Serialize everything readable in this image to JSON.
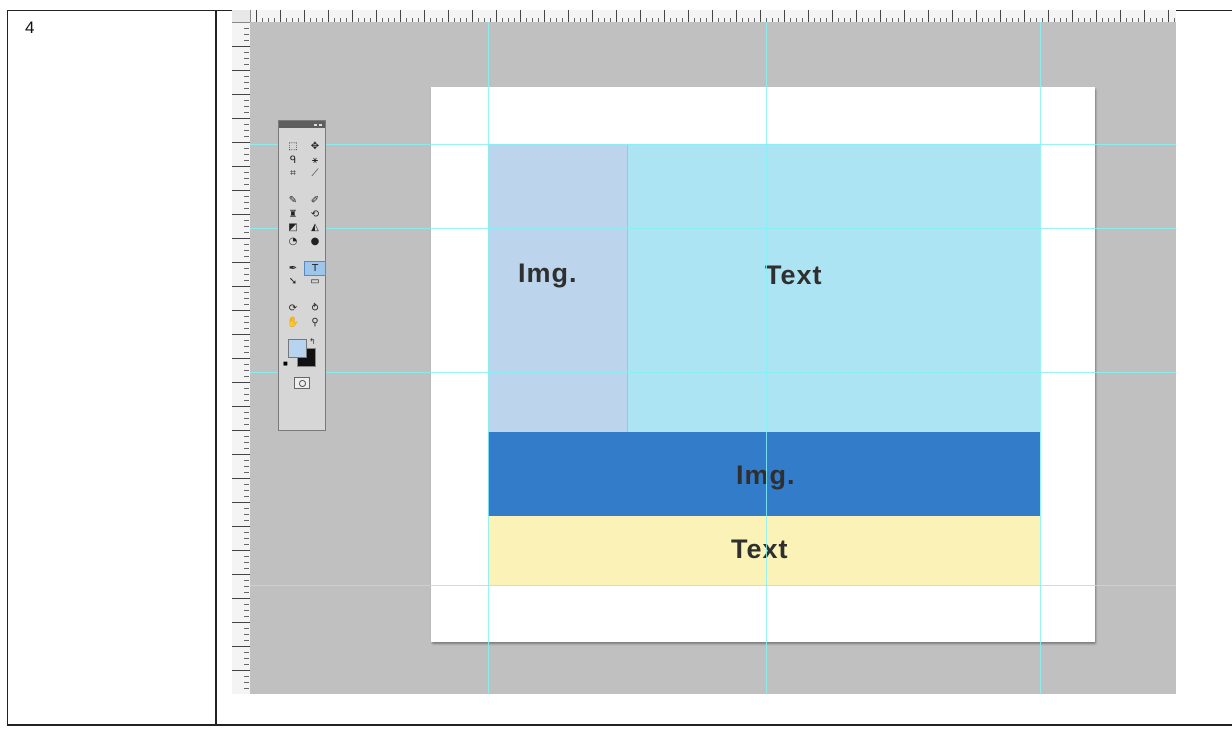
{
  "step": {
    "number": "4"
  },
  "canvas": {
    "blocks": {
      "top_image_label": "Img.",
      "top_text_label": "Text",
      "middle_image_label": "Img.",
      "bottom_text_label": "Text"
    },
    "colors": {
      "workspace": "#c0c0c0",
      "document": "#ffffff",
      "top_image": "#bcd4ec",
      "top_text": "#ade4f4",
      "middle_image": "#327cca",
      "bottom_text": "#faf2b6",
      "guides": "#86f0f4"
    }
  },
  "tools_panel": {
    "tools": [
      {
        "name": "marquee-tool-icon",
        "glyph": "⬚"
      },
      {
        "name": "move-tool-icon",
        "glyph": "✥"
      },
      {
        "name": "lasso-tool-icon",
        "glyph": "ᑫ"
      },
      {
        "name": "magic-wand-tool-icon",
        "glyph": "⚹"
      },
      {
        "name": "crop-tool-icon",
        "glyph": "⌗"
      },
      {
        "name": "eyedropper-tool-icon",
        "glyph": "⟋"
      },
      {
        "name": "healing-brush-tool-icon",
        "glyph": "✎"
      },
      {
        "name": "brush-tool-icon",
        "glyph": "✐"
      },
      {
        "name": "clone-stamp-tool-icon",
        "glyph": "♜"
      },
      {
        "name": "history-brush-tool-icon",
        "glyph": "⟲"
      },
      {
        "name": "eraser-tool-icon",
        "glyph": "◩"
      },
      {
        "name": "paint-bucket-tool-icon",
        "glyph": "◭"
      },
      {
        "name": "blur-tool-icon",
        "glyph": "◔"
      },
      {
        "name": "dodge-tool-icon",
        "glyph": "●"
      },
      {
        "name": "pen-tool-icon",
        "glyph": "✒"
      },
      {
        "name": "type-tool-icon",
        "glyph": "T",
        "active": true
      },
      {
        "name": "path-selection-tool-icon",
        "glyph": "➘"
      },
      {
        "name": "shape-tool-icon",
        "glyph": "▭"
      },
      {
        "name": "3d-rotate-tool-icon",
        "glyph": "⟳"
      },
      {
        "name": "3d-orbit-tool-icon",
        "glyph": "⥁"
      },
      {
        "name": "hand-tool-icon",
        "glyph": "✋"
      },
      {
        "name": "zoom-tool-icon",
        "glyph": "⚲"
      }
    ],
    "foreground_color": "#b6d3f0",
    "background_color": "#111111"
  }
}
